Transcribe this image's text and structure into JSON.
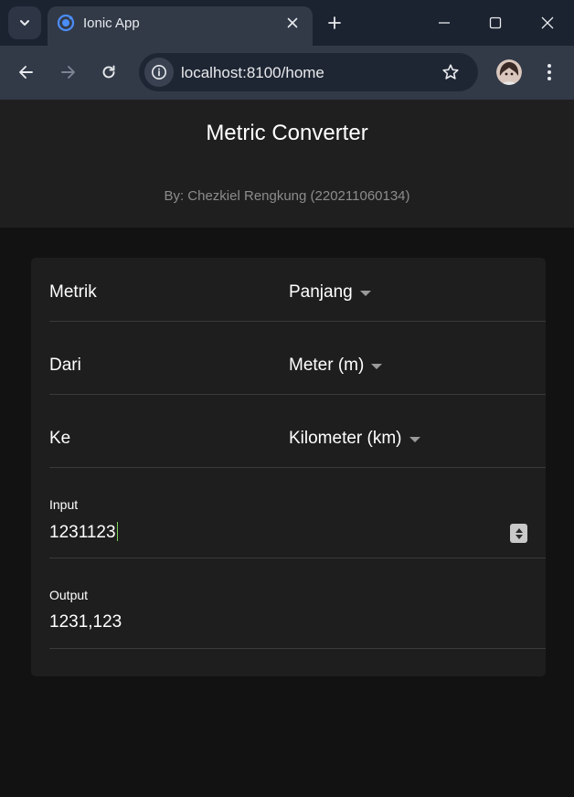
{
  "browser": {
    "tab_title": "Ionic App",
    "url": "localhost:8100/home"
  },
  "icons": {
    "tab_search": "chevron-down-icon",
    "favicon": "ionic-icon",
    "tab_close": "close-icon",
    "new_tab": "plus-icon",
    "minimize": "minimize-icon",
    "maximize": "maximize-icon",
    "window_close": "close-icon",
    "back": "arrow-left-icon",
    "forward": "arrow-right-icon",
    "reload": "reload-icon",
    "site_info": "info-icon",
    "bookmark": "star-icon",
    "menu": "kebab-icon"
  },
  "header": {
    "title": "Metric Converter",
    "subtitle": "By: Chezkiel Rengkung (220211060134)"
  },
  "form": {
    "metric": {
      "label": "Metrik",
      "value": "Panjang"
    },
    "from": {
      "label": "Dari",
      "value": "Meter (m)"
    },
    "to": {
      "label": "Ke",
      "value": "Kilometer (km)"
    },
    "input": {
      "label": "Input",
      "value": "1231123"
    },
    "output": {
      "label": "Output",
      "value": "1231,123"
    }
  },
  "colors": {
    "browser_tabstrip": "#1b2230",
    "browser_toolbar": "#323a48",
    "page_background": "#121212",
    "header_background": "#1f1f1f",
    "card_background": "#1e1e1e",
    "text_cursor": "#7bd35a"
  }
}
